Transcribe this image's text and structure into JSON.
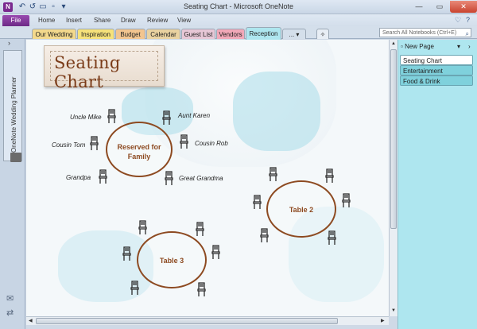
{
  "window": {
    "title": "Seating Chart - Microsoft OneNote",
    "app_icon": "N"
  },
  "ribbon": {
    "file": "File",
    "tabs": [
      "Home",
      "Insert",
      "Share",
      "Draw",
      "Review",
      "View"
    ]
  },
  "sections": {
    "tabs": [
      {
        "label": "Our Wedding",
        "color": "#f3d98c"
      },
      {
        "label": "Inspiration",
        "color": "#f6e27a"
      },
      {
        "label": "Budget",
        "color": "#f2c58f"
      },
      {
        "label": "Calendar",
        "color": "#e9d2a0"
      },
      {
        "label": "Guest List",
        "color": "#e7c7d6"
      },
      {
        "label": "Vendors",
        "color": "#f1a8b8"
      },
      {
        "label": "Reception",
        "color": "#aee6ef"
      },
      {
        "label": "...",
        "color": "#d4dfeb"
      }
    ],
    "active": "Reception",
    "search_placeholder": "Search All Notebooks (Ctrl+E)"
  },
  "notebook": {
    "name": "OneNote Wedding Planner"
  },
  "page": {
    "title": "Seating Chart",
    "tables": [
      {
        "label": "Reserved for Family"
      },
      {
        "label": "Table 2"
      },
      {
        "label": "Table 3"
      }
    ],
    "guests": [
      "Uncle Mike",
      "Aunt Karen",
      "Cousin Tom",
      "Cousin Rob",
      "Grandpa",
      "Great Grandma"
    ]
  },
  "pages_panel": {
    "new_page": "New Page",
    "pages": [
      {
        "label": "Seating Chart",
        "active": true
      },
      {
        "label": "Entertainment",
        "active": false
      },
      {
        "label": "Food & Drink",
        "active": false
      }
    ]
  }
}
